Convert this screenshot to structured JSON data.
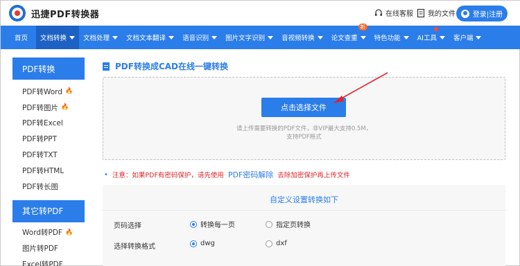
{
  "header": {
    "logo_text": "迅捷PDF转换器",
    "service_label": "在线客服",
    "service_icon": "headset-icon",
    "files_label": "我的文件",
    "files_icon": "document-icon",
    "login_label": "登录|注册"
  },
  "nav": {
    "items": [
      {
        "label": "首页"
      },
      {
        "label": "文档转换"
      },
      {
        "label": "文档处理"
      },
      {
        "label": "文档文本翻译"
      },
      {
        "label": "语音识别"
      },
      {
        "label": "图片文字识别"
      },
      {
        "label": "音视频转换"
      },
      {
        "label": "论文查重",
        "badge": "新"
      },
      {
        "label": "特色功能"
      },
      {
        "label": "AI工具"
      },
      {
        "label": "客户端"
      }
    ]
  },
  "sidebar": {
    "groups": [
      {
        "title": "PDF转换",
        "items": [
          {
            "label": "PDF转Word",
            "hot": true
          },
          {
            "label": "PDF转图片",
            "hot": true
          },
          {
            "label": "PDF转Excel"
          },
          {
            "label": "PDF转PPT"
          },
          {
            "label": "PDF转TXT"
          },
          {
            "label": "PDF转HTML"
          },
          {
            "label": "PDF转长图"
          }
        ]
      },
      {
        "title": "其它转PDF",
        "items": [
          {
            "label": "Word转PDF",
            "hot": true
          },
          {
            "label": "图片转PDF"
          },
          {
            "label": "Excel转PDF"
          }
        ]
      }
    ]
  },
  "main": {
    "title": "PDF转换成CAD在线一键转换",
    "upload_button": "点击选择文件",
    "upload_hint_1": "请上传需要转换的PDF文件，非VIP最大支持0.5M，",
    "upload_hint_2": "支持PDF格式",
    "notice_prefix": "注意：如果PDF有密码保护，请先使用",
    "notice_link": "PDF密码解除",
    "notice_suffix": "去除加密保护再上传文件"
  },
  "settings": {
    "title": "自定义设置转换如下",
    "page_label": "页码选择",
    "page_options": [
      "转换每一页",
      "指定页转换"
    ],
    "page_selected": "转换每一页",
    "format_label": "选择转换格式",
    "format_options": [
      "dwg",
      "dxf"
    ],
    "format_selected": "dwg"
  },
  "colors": {
    "brand": "#2b7de9",
    "nav_active": "#1d61c4",
    "warning": "#e0262b",
    "hot": "#ff6a2b"
  }
}
